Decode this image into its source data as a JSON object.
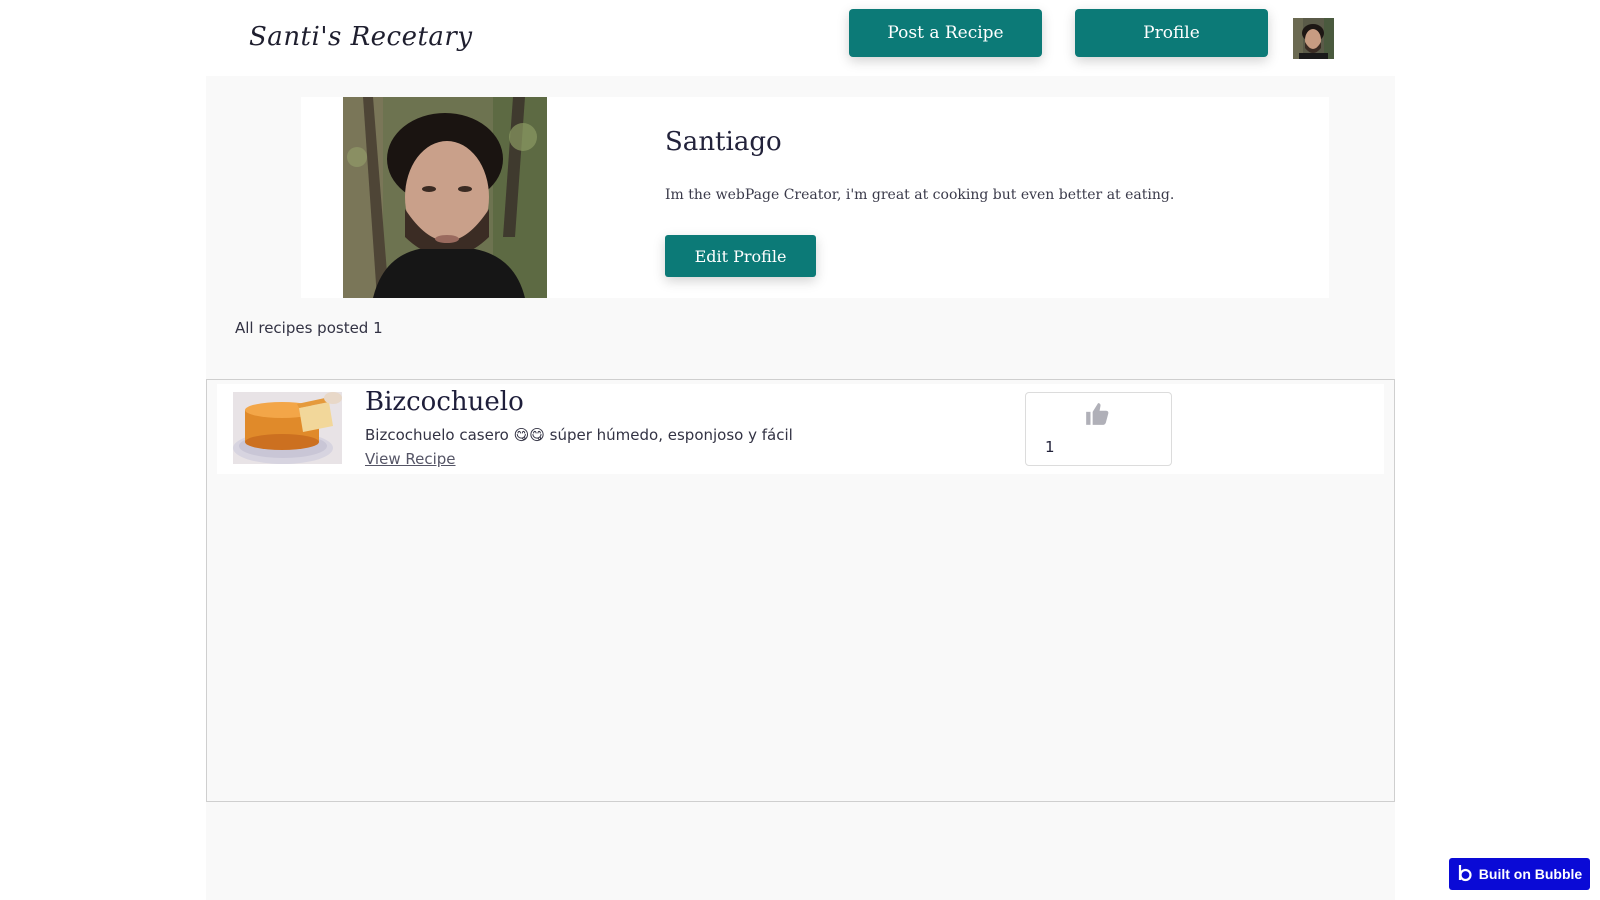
{
  "header": {
    "brand": "Santi's Recetary",
    "post_recipe_label": "Post a Recipe",
    "profile_label": "Profile"
  },
  "profile": {
    "name": "Santiago",
    "bio": "Im the webPage Creator, i'm great at cooking but even better at eating.",
    "edit_label": "Edit Profile"
  },
  "recipes": {
    "count_label": "All recipes posted 1",
    "items": [
      {
        "title": "Bizcochuelo",
        "description": "Bizcochuelo casero 😋😋 súper húmedo, esponjoso y fácil",
        "link_label": "View Recipe",
        "likes": "1"
      }
    ]
  },
  "badge": {
    "label": "Built on Bubble"
  },
  "colors": {
    "accent": "#0c7a77",
    "badge": "#0a0ad6",
    "background": "#f9f9f9"
  },
  "icons": [
    "avatar",
    "thumbs-up-icon",
    "bubble-logo-icon"
  ]
}
